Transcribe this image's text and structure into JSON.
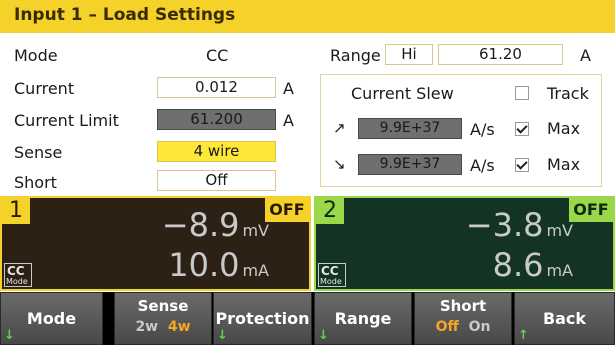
{
  "title": "Input 1 – Load Settings",
  "settings": {
    "mode_label": "Mode",
    "mode_value": "CC",
    "current_label": "Current",
    "current_value": "0.012",
    "current_unit": "A",
    "current_limit_label": "Current Limit",
    "current_limit_value": "61.200",
    "current_limit_unit": "A",
    "sense_label": "Sense",
    "sense_value": "4 wire",
    "short_label": "Short",
    "short_value": "Off"
  },
  "range": {
    "label": "Range",
    "level": "Hi",
    "value": "61.20",
    "unit": "A"
  },
  "slew": {
    "label": "Current Slew",
    "track_label": "Track",
    "track_checked": false,
    "up_icon": "up-right-arrow-icon",
    "up_value": "9.9E+37",
    "up_unit": "A/s",
    "up_max_label": "Max",
    "up_max_checked": true,
    "down_icon": "down-right-arrow-icon",
    "down_value": "9.9E+37",
    "down_unit": "A/s",
    "down_max_label": "Max",
    "down_max_checked": true
  },
  "channels": [
    {
      "number": "1",
      "state": "OFF",
      "voltage": "−8.9",
      "voltage_unit": "mV",
      "current": "10.0",
      "current_unit": "mA",
      "mode": "CC",
      "mode_caption": "Mode",
      "accent": "#f5d22a",
      "background": "#2d2015"
    },
    {
      "number": "2",
      "state": "OFF",
      "voltage": "−3.8",
      "voltage_unit": "mV",
      "current": "8.6",
      "current_unit": "mA",
      "mode": "CC",
      "mode_caption": "Mode",
      "accent": "#9ad84a",
      "background": "#133424"
    }
  ],
  "softkeys": {
    "mode": "Mode",
    "sense": "Sense",
    "sense_opt1": "2w",
    "sense_opt2": "4w",
    "protection": "Protection",
    "range": "Range",
    "short": "Short",
    "short_opt1": "Off",
    "short_opt2": "On",
    "back": "Back",
    "down_arrow_icon": "down-arrow-icon",
    "up_arrow_icon": "up-arrow-icon"
  }
}
